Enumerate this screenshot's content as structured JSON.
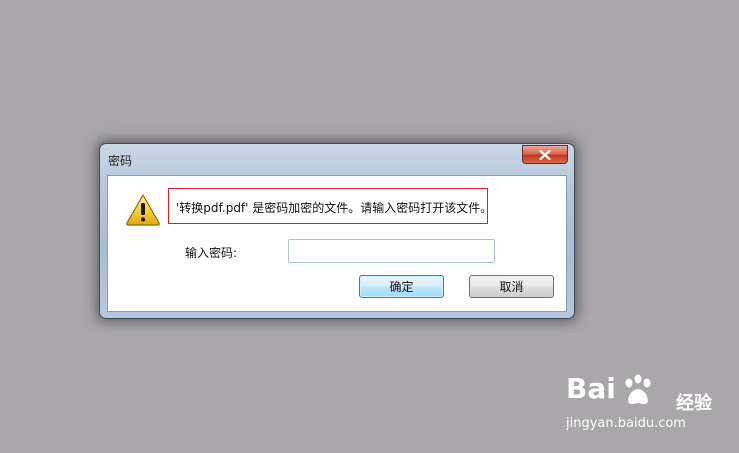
{
  "dialog": {
    "title": "密码",
    "message": "'转换pdf.pdf' 是密码加密的文件。请输入密码打开该文件。",
    "password_label": "输入密码:",
    "password_value": "",
    "ok_label": "确定",
    "cancel_label": "取消",
    "icons": {
      "close": "close-icon",
      "warning": "warning-icon"
    },
    "highlight_color": "#d8232a"
  },
  "watermark": {
    "logo_text": "Bai",
    "brand_text": "经验",
    "url": "jingyan.baidu.com"
  }
}
